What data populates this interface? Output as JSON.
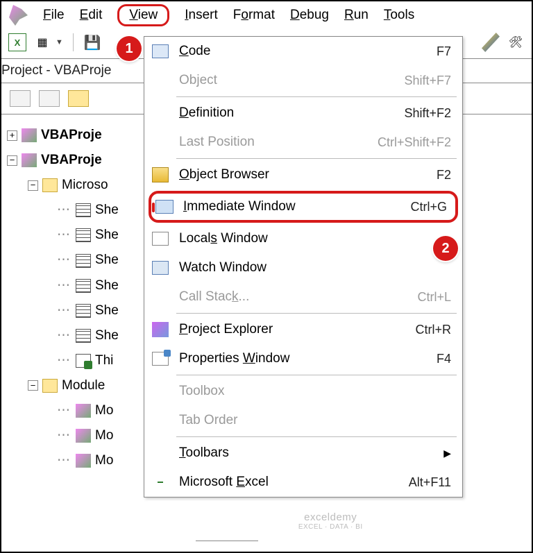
{
  "menubar": {
    "items": [
      "File",
      "Edit",
      "View",
      "Insert",
      "Format",
      "Debug",
      "Run",
      "Tools"
    ],
    "active_index": 2
  },
  "panel": {
    "title": "Project - VBAProje"
  },
  "tree": {
    "root1": "VBAProje",
    "root2": "VBAProje",
    "msgroup": "Microso",
    "sheets": [
      "She",
      "She",
      "She",
      "She",
      "She",
      "She"
    ],
    "thiswb": "Thi",
    "modgroup": "Module",
    "modules": [
      "Mo",
      "Mo",
      "Mo"
    ]
  },
  "menu": {
    "items": [
      {
        "label": "Code",
        "shortcut": "F7",
        "u": 0,
        "icon": "ic-code",
        "enabled": true
      },
      {
        "label": "Object",
        "shortcut": "Shift+F7",
        "u": -1,
        "enabled": false
      },
      {
        "sep": true
      },
      {
        "label": "Definition",
        "shortcut": "Shift+F2",
        "u": 0,
        "icon": "ic-def",
        "enabled": true
      },
      {
        "label": "Last Position",
        "shortcut": "Ctrl+Shift+F2",
        "u": -1,
        "enabled": false
      },
      {
        "sep": true
      },
      {
        "label": "Object Browser",
        "shortcut": "F2",
        "u": 0,
        "icon": "ic-objb",
        "enabled": true
      },
      {
        "label": "Immediate Window",
        "shortcut": "Ctrl+G",
        "u": 0,
        "icon": "ic-imm",
        "enabled": true,
        "highlight": true
      },
      {
        "label": "Locals Window",
        "shortcut": "",
        "u": 5,
        "icon": "ic-loc",
        "enabled": true
      },
      {
        "label": "Watch Window",
        "shortcut": "",
        "u": -1,
        "icon": "ic-watch",
        "enabled": true
      },
      {
        "label": "Call Stack...",
        "shortcut": "Ctrl+L",
        "u": 9,
        "enabled": false
      },
      {
        "sep": true
      },
      {
        "label": "Project Explorer",
        "shortcut": "Ctrl+R",
        "u": 0,
        "icon": "ic-pe",
        "enabled": true
      },
      {
        "label": "Properties Window",
        "shortcut": "F4",
        "u": 11,
        "icon": "ic-pw",
        "enabled": true
      },
      {
        "sep": true
      },
      {
        "label": "Toolbox",
        "shortcut": "",
        "u": -1,
        "icon": "ic-tb",
        "enabled": false
      },
      {
        "label": "Tab Order",
        "shortcut": "",
        "u": -1,
        "enabled": false
      },
      {
        "sep": true
      },
      {
        "label": "Toolbars",
        "shortcut": "",
        "u": 0,
        "arrow": true,
        "enabled": true
      },
      {
        "label": "Microsoft Excel",
        "shortcut": "Alt+F11",
        "u": 10,
        "icon": "ic-excel",
        "enabled": true
      }
    ]
  },
  "callouts": {
    "b1": "1",
    "b2": "2"
  },
  "watermark": {
    "line1": "exceldemy",
    "line2": "EXCEL · DATA · BI"
  }
}
